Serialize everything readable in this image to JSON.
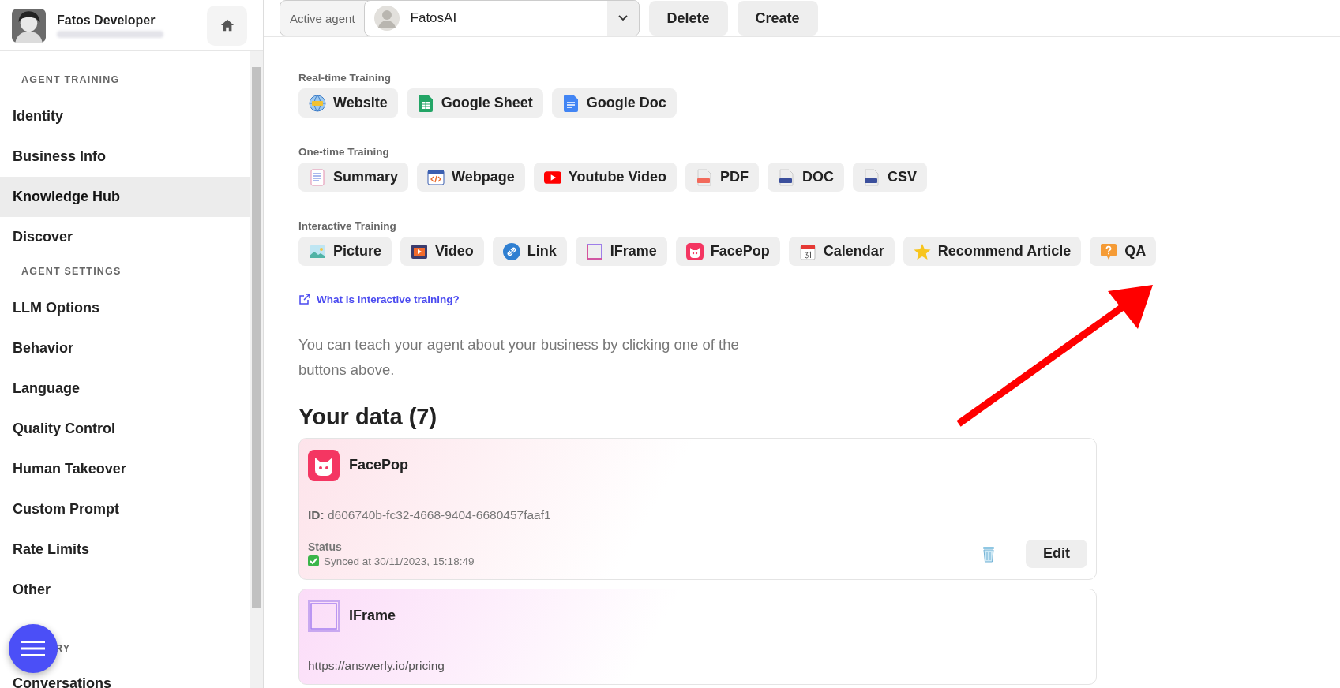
{
  "user": {
    "name": "Fatos Developer"
  },
  "sidebar": {
    "sections": [
      {
        "label": "AGENT TRAINING",
        "items": [
          {
            "label": "Identity",
            "selected": false
          },
          {
            "label": "Business Info",
            "selected": false
          },
          {
            "label": "Knowledge Hub",
            "selected": true
          },
          {
            "label": "Discover",
            "selected": false
          }
        ]
      },
      {
        "label": "AGENT SETTINGS",
        "items": [
          {
            "label": "LLM Options",
            "selected": false
          },
          {
            "label": "Behavior",
            "selected": false
          },
          {
            "label": "Language",
            "selected": false
          },
          {
            "label": "Quality Control",
            "selected": false
          },
          {
            "label": "Human Takeover",
            "selected": false
          },
          {
            "label": "Custom Prompt",
            "selected": false
          },
          {
            "label": "Rate Limits",
            "selected": false
          },
          {
            "label": "Other",
            "selected": false
          }
        ]
      },
      {
        "label": "RY",
        "items": [
          {
            "label": "Conversations",
            "selected": false
          }
        ]
      }
    ]
  },
  "topbar": {
    "agent_label": "Active agent",
    "agent_value": "FatosAI",
    "buttons": [
      "Delete",
      "Create"
    ]
  },
  "training": [
    {
      "title": "Real-time Training",
      "buttons": [
        "Website",
        "Google Sheet",
        "Google Doc"
      ]
    },
    {
      "title": "One-time Training",
      "buttons": [
        "Summary",
        "Webpage",
        "Youtube Video",
        "PDF",
        "DOC",
        "CSV"
      ]
    },
    {
      "title": "Interactive Training",
      "buttons": [
        "Picture",
        "Video",
        "Link",
        "IFrame",
        "FacePop",
        "Calendar",
        "Recommend Article",
        "QA"
      ]
    }
  ],
  "help_link": "What is interactive training?",
  "intro": "You can teach your agent about your business by clicking one of the buttons above.",
  "data_heading": "Your data (7)",
  "cards": [
    {
      "kind": "facepop",
      "title": "FacePop",
      "id_label": "ID:",
      "id_value": "d606740b-fc32-4668-9404-6680457faaf1",
      "status_label": "Status",
      "status": "Synced at 30/11/2023, 15:18:49",
      "edit": "Edit"
    },
    {
      "kind": "iframe",
      "title": "IFrame",
      "url": "https://answerly.io/pricing"
    }
  ]
}
